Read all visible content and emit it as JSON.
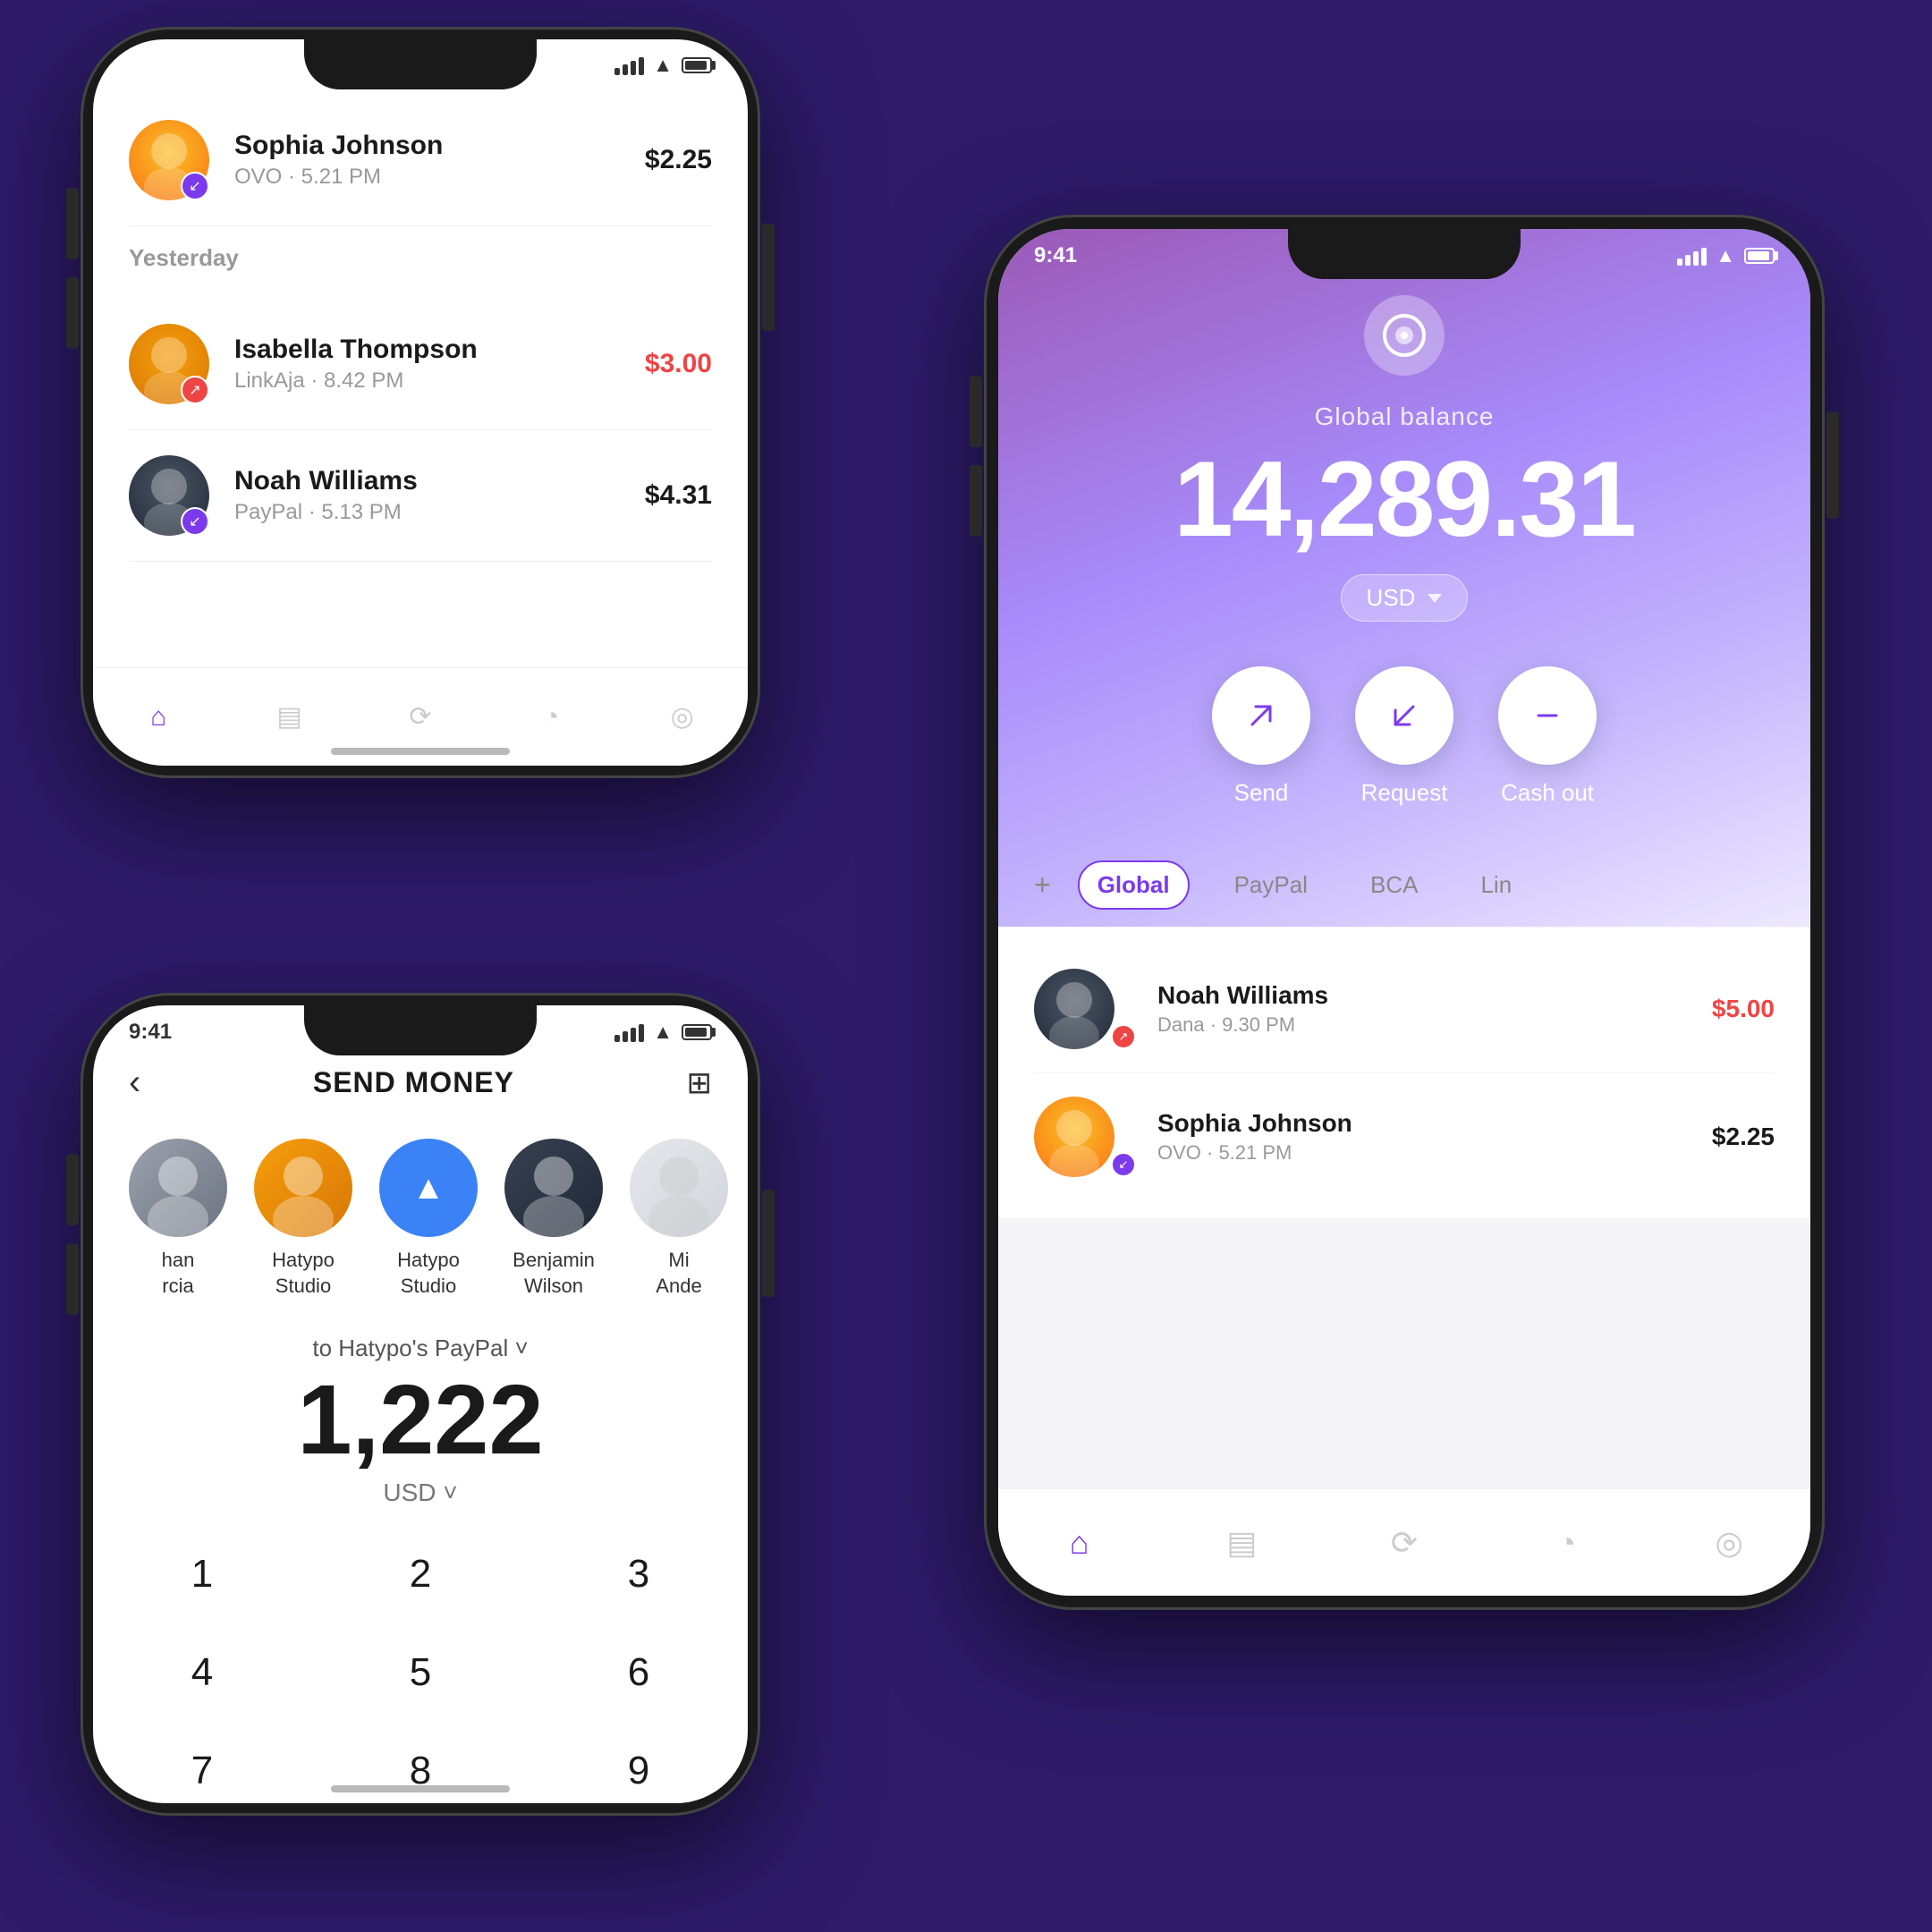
{
  "background": "#2d1b69",
  "phone1": {
    "status_time": "",
    "section_yesterday": "Yesterday",
    "transactions_top": [
      {
        "name": "Sophia Johnson",
        "sub": "OVO · 5.21 PM",
        "amount": "$2.25",
        "type": "positive",
        "badge_icon": "↙",
        "badge_color": "purple",
        "avatar_class": "sophia-av"
      }
    ],
    "transactions_yesterday": [
      {
        "name": "Isabella Thompson",
        "sub": "LinkAja · 8.42 PM",
        "amount": "$3.00",
        "type": "negative",
        "badge_icon": "↗",
        "badge_color": "red",
        "avatar_class": "isabella-av"
      },
      {
        "name": "Noah Williams",
        "sub": "PayPal · 5.13 PM",
        "amount": "$4.31",
        "type": "positive",
        "badge_icon": "↙",
        "badge_color": "purple",
        "avatar_class": "noah-av"
      }
    ],
    "nav_items": [
      "🏠",
      "📋",
      "⟳",
      "🕐",
      "👤"
    ]
  },
  "phone2": {
    "status_time": "9:41",
    "title": "SEND MONEY",
    "back_label": "‹",
    "contacts": [
      {
        "name": "han\nrcia",
        "avatar_class": "garcia-av"
      },
      {
        "name": "Hatypo\nStudio",
        "avatar_class": "hatypo-studio-av",
        "selected": false
      },
      {
        "name": "Hatypo\nStudio",
        "avatar_class": "hatypo-blue-av",
        "selected": true
      },
      {
        "name": "Benjamin\nWilson",
        "avatar_class": "benjamin-av",
        "selected": false
      },
      {
        "name": "Mi\nAnde",
        "avatar_class": "mia-av",
        "selected": false
      }
    ],
    "send_to": "to Hatypo's PayPal ˅",
    "amount": "1,222",
    "currency": "USD ˅",
    "numpad": [
      "1",
      "2",
      "3",
      "4",
      "5",
      "6",
      "7",
      "8",
      "9"
    ]
  },
  "phone3": {
    "status_time": "9:41",
    "balance_label": "Global balance",
    "balance_amount": "14,289.31",
    "currency": "USD",
    "action_send": "Send",
    "action_request": "Request",
    "action_cashout": "Cash out",
    "wallet_plus": "+",
    "wallet_tabs": [
      "Global",
      "PayPal",
      "BCA",
      "Lin"
    ],
    "active_tab": "Global",
    "transactions": [
      {
        "name": "Noah Williams",
        "sub": "Dana · 9.30 PM",
        "amount": "$5.00",
        "type": "negative",
        "badge_icon": "↗",
        "badge_color": "red",
        "avatar_class": "noah-av"
      },
      {
        "name": "Sophia Johnson",
        "sub": "OVO · 5.21 PM",
        "amount": "$2.25",
        "type": "positive",
        "badge_icon": "↙",
        "badge_color": "purple",
        "avatar_class": "sophia-av"
      }
    ],
    "nav_items": [
      "🏠",
      "📋",
      "⟳",
      "🕐",
      "👤"
    ]
  }
}
